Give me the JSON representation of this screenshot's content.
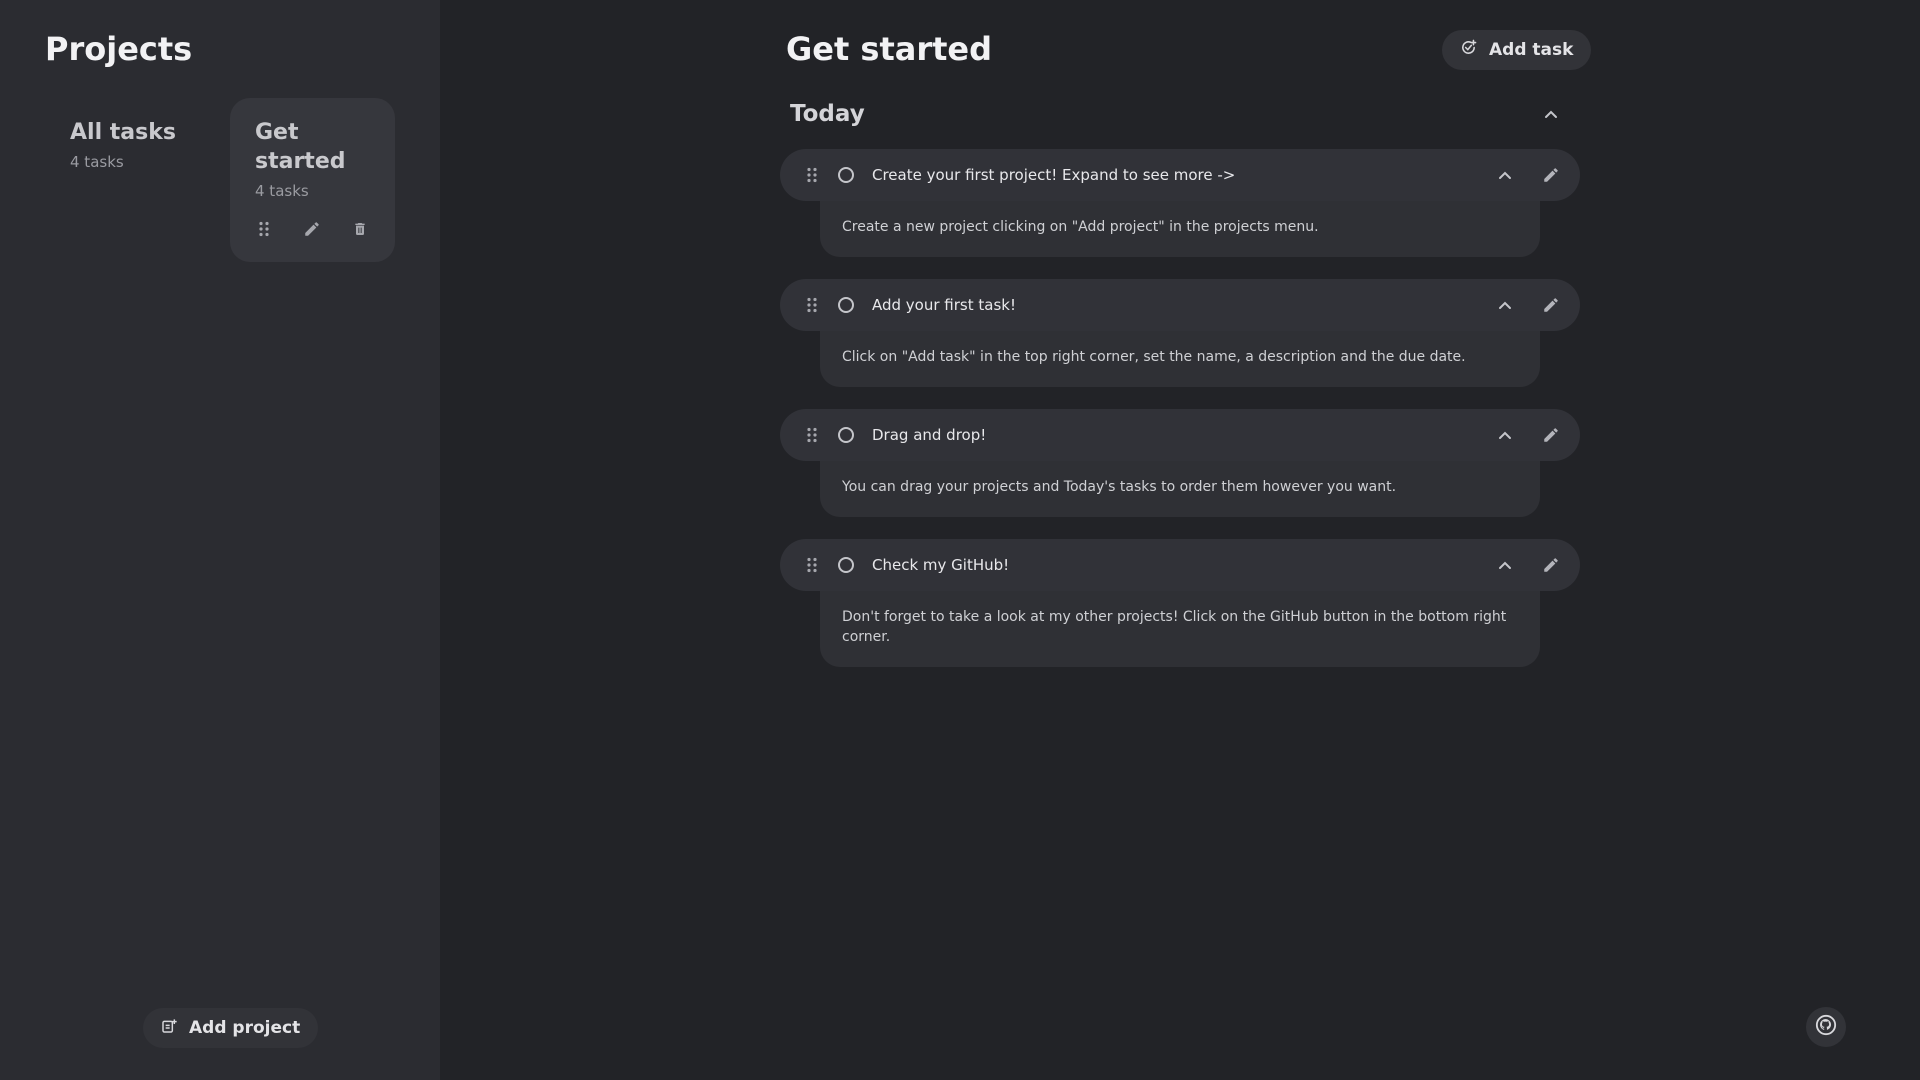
{
  "sidebar": {
    "title": "Projects",
    "projects": [
      {
        "name": "All tasks",
        "count": "4 tasks"
      },
      {
        "name": "Get started",
        "count": "4 tasks"
      }
    ],
    "add_project_label": "Add project"
  },
  "main": {
    "title": "Get started",
    "add_task_label": "Add task",
    "section_title": "Today",
    "tasks": [
      {
        "name": "Create your first project! Expand to see more ->",
        "description": "Create a new project clicking on \"Add project\" in the projects menu."
      },
      {
        "name": "Add your first task!",
        "description": "Click on \"Add task\" in the top right corner, set the name, a description and the due date."
      },
      {
        "name": "Drag and drop!",
        "description": "You can drag your projects and Today's tasks to order them however you want."
      },
      {
        "name": "Check my GitHub!",
        "description": "Don't forget to take a look at my other projects! Click on the GitHub button in the bottom right corner."
      }
    ]
  },
  "icons": {
    "drag": "drag-handle-icon",
    "edit": "pencil-icon",
    "delete": "trash-icon",
    "collapse": "chevron-up-icon",
    "add_task": "add-task-icon",
    "add_project": "add-project-icon",
    "github": "github-icon"
  },
  "colors": {
    "background": "#222327",
    "sidebar": "#2b2c31",
    "card": "#36373d",
    "task_row": "#313238",
    "task_desc": "#2f3035"
  }
}
